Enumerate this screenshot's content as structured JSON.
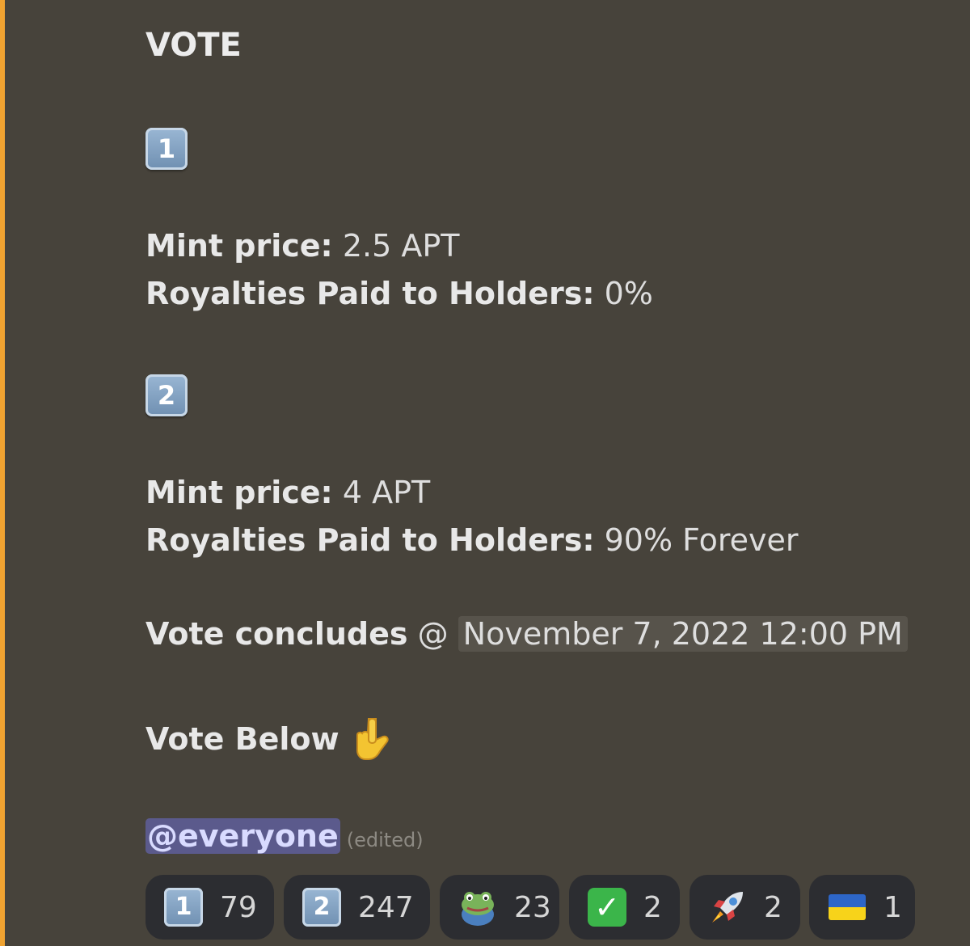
{
  "message": {
    "heading": "VOTE",
    "option1": {
      "keycap": "1",
      "mint_label": "Mint price:",
      "mint_value": " 2.5 APT",
      "royalties_label": "Royalties Paid to Holders:",
      "royalties_value": " 0%"
    },
    "option2": {
      "keycap": "2",
      "mint_label": "Mint price:",
      "mint_value": " 4 APT",
      "royalties_label": "Royalties Paid to Holders:",
      "royalties_value": " 90% Forever"
    },
    "conclude_label": "Vote concludes",
    "conclude_at": " @ ",
    "conclude_timestamp": "November 7, 2022 12:00 PM",
    "vote_below": "Vote Below",
    "mention": "@everyone",
    "edited": "(edited)"
  },
  "reactions": [
    {
      "emoji": "keycap-1",
      "label": "1",
      "count": "79"
    },
    {
      "emoji": "keycap-2",
      "label": "2",
      "count": "247"
    },
    {
      "emoji": "frog-emoji",
      "label": "",
      "count": "23"
    },
    {
      "emoji": "check-mark-button",
      "label": "✓",
      "count": "2"
    },
    {
      "emoji": "rocket",
      "label": "",
      "count": "2"
    },
    {
      "emoji": "ukraine-flag",
      "label": "",
      "count": "1"
    }
  ],
  "colors": {
    "background": "#47433b",
    "accent_bar": "#f0a331",
    "reaction_bg": "#2c2d31",
    "mention_bg": "#5b5a8c"
  }
}
